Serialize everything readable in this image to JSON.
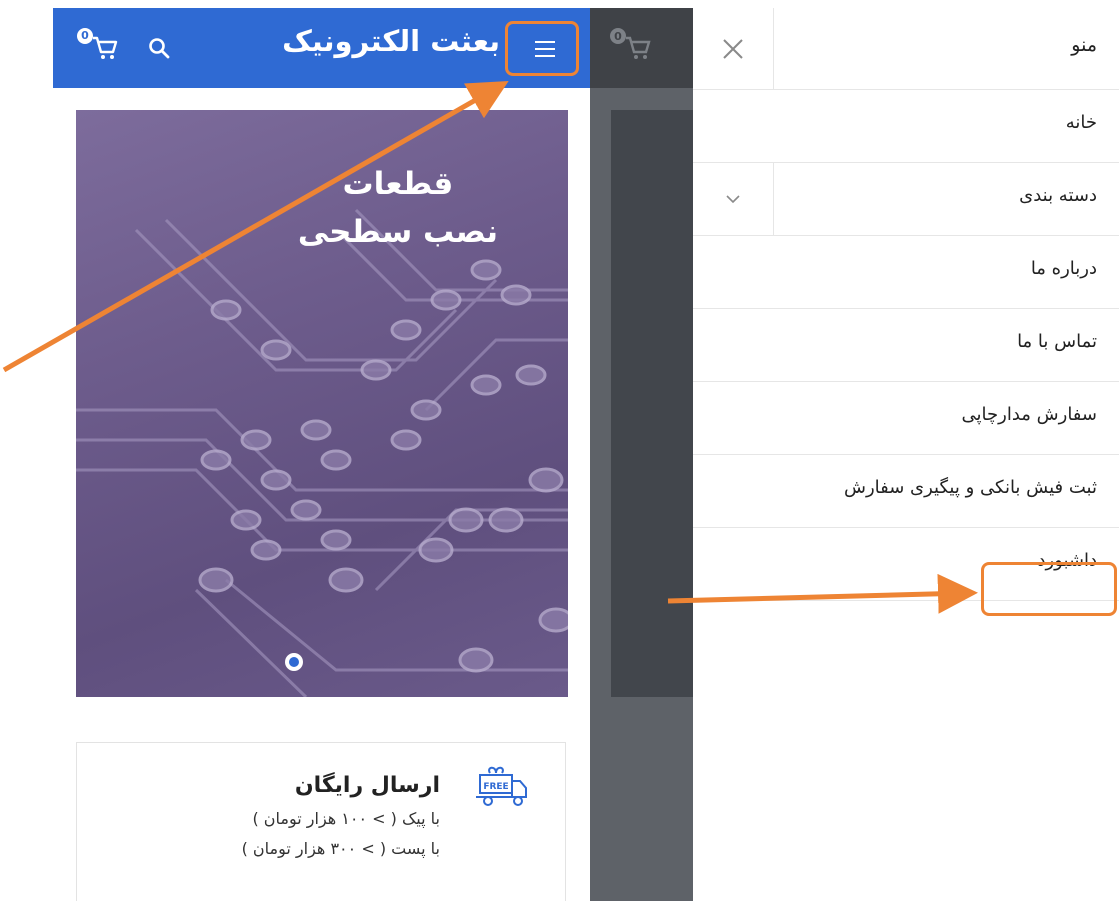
{
  "left_screen": {
    "app_title": "بعثت الکترونیک",
    "cart_count": "0",
    "hero": {
      "line1": "قطعات",
      "line2": "نصب سطحی"
    },
    "free_shipping": {
      "icon_label": "FREE",
      "title": "ارسال رایگان",
      "line1": "با پیک ( > ۱۰۰ هزار تومان )",
      "line2": "با پست ( > ۳۰۰ هزار تومان )"
    }
  },
  "right_screen": {
    "cart_count": "0",
    "drawer": {
      "title": "منو",
      "items": [
        {
          "label": "خانه"
        },
        {
          "label": "دسته بندی"
        },
        {
          "label": "درباره ما"
        },
        {
          "label": "تماس با ما"
        },
        {
          "label": "سفارش مدارچاپی"
        },
        {
          "label": "ثبت فیش بانکی و پیگیری سفارش"
        },
        {
          "label": "داشبورد"
        }
      ]
    }
  },
  "colors": {
    "brand_blue": "#2f6ad3",
    "annotation_orange": "#ee8434"
  }
}
